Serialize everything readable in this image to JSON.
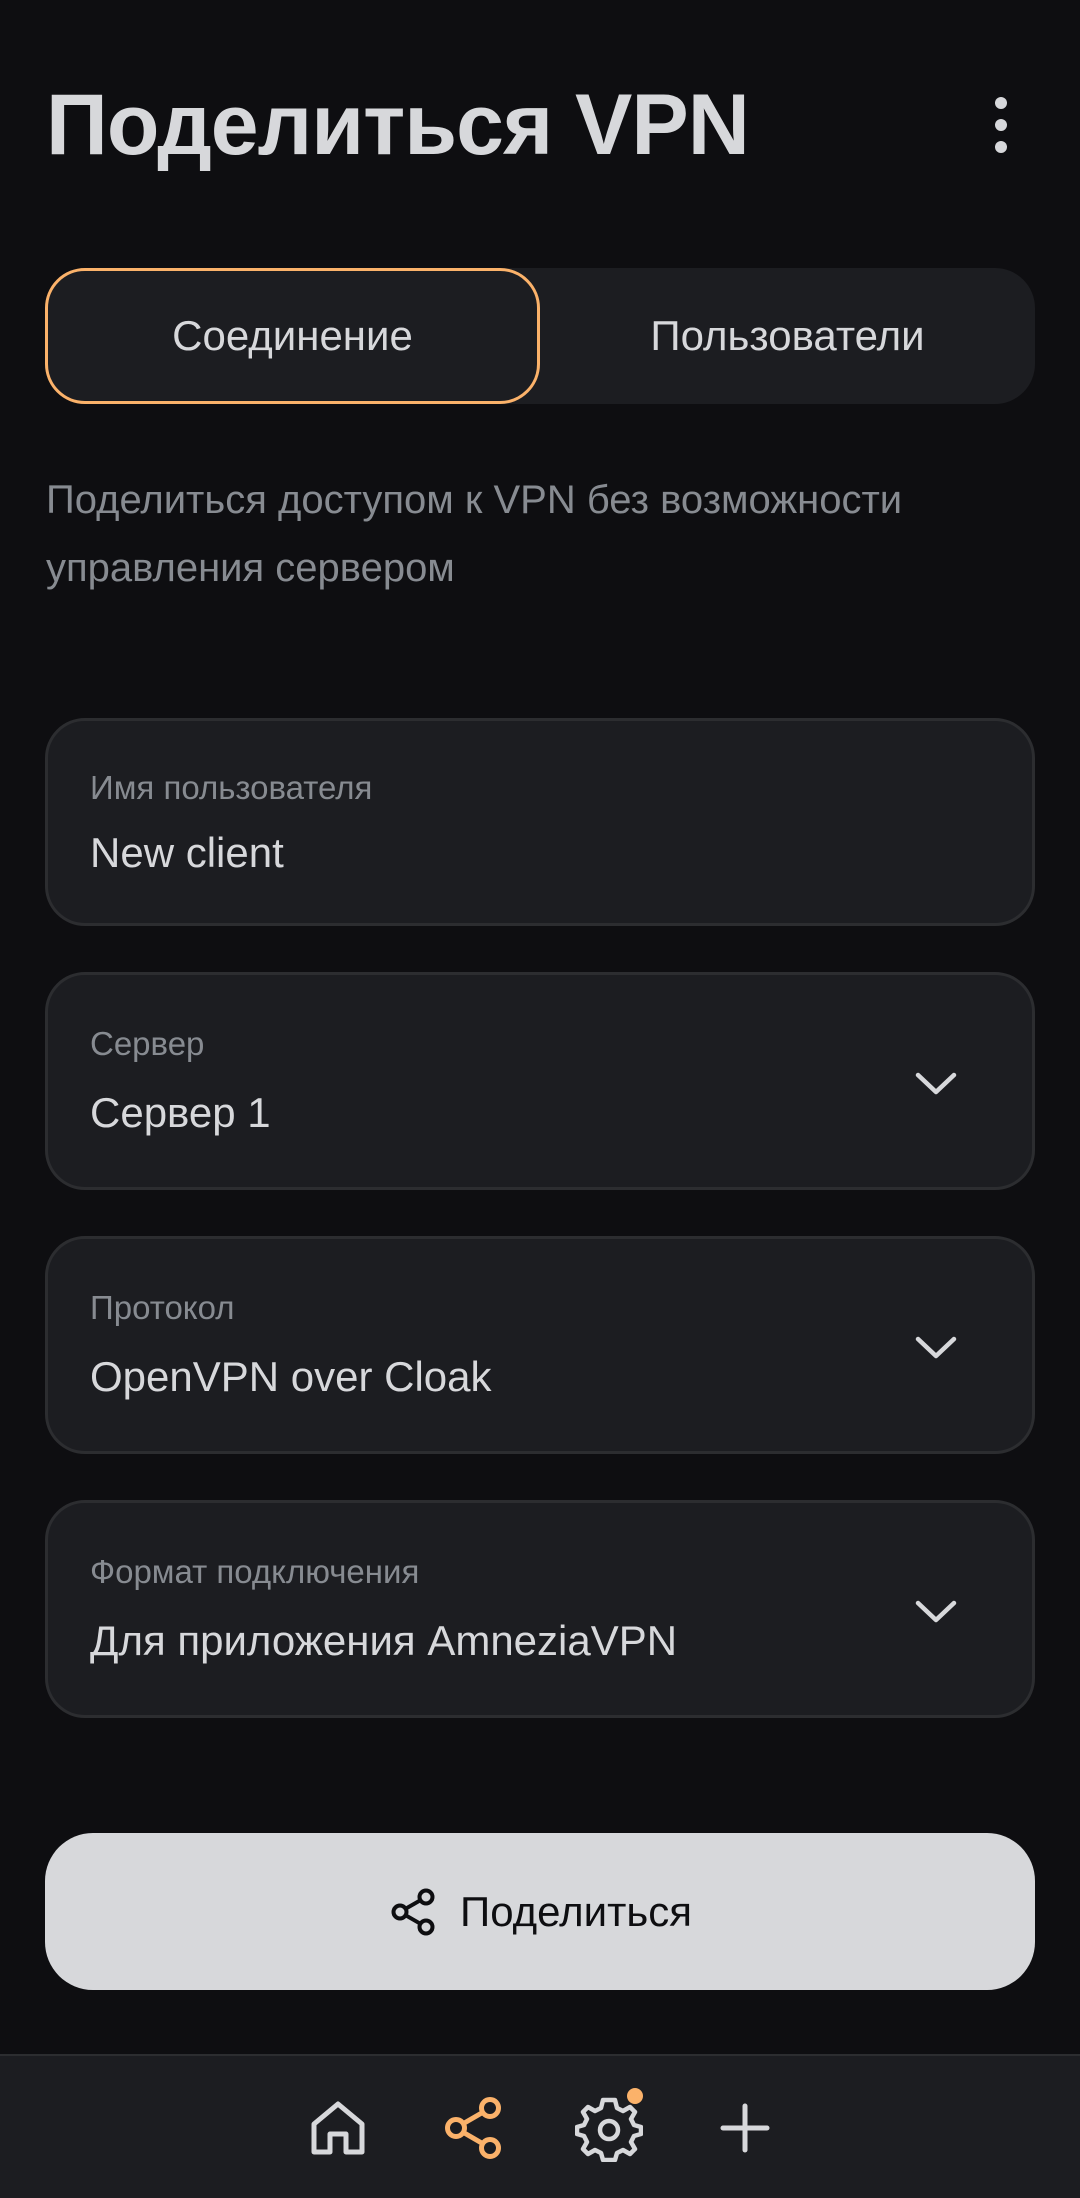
{
  "header": {
    "title": "Поделиться VPN",
    "menu_icon": "more-vertical-icon"
  },
  "tabs": [
    {
      "label": "Соединение",
      "selected": true
    },
    {
      "label": "Пользователи",
      "selected": false
    }
  ],
  "description": "Поделиться доступом к VPN без возможности управления сервером",
  "fields": {
    "username": {
      "label": "Имя пользователя",
      "value": "New client"
    },
    "server": {
      "label": "Сервер",
      "value": "Сервер 1"
    },
    "protocol": {
      "label": "Протокол",
      "value": "OpenVPN over Cloak"
    },
    "format": {
      "label": "Формат подключения",
      "value": "Для приложения AmneziaVPN"
    }
  },
  "share_button": {
    "label": "Поделиться",
    "icon": "share-icon"
  },
  "bottom_nav": {
    "items": [
      {
        "icon": "home-icon",
        "active": false
      },
      {
        "icon": "share-icon",
        "active": true
      },
      {
        "icon": "settings-icon",
        "active": false,
        "badge": true
      },
      {
        "icon": "plus-icon",
        "active": false
      }
    ]
  },
  "colors": {
    "background": "#0E0E11",
    "surface": "#1C1D21",
    "accent": "#FBB26A",
    "text_primary": "#D7D8DB",
    "text_secondary": "#878B91"
  }
}
